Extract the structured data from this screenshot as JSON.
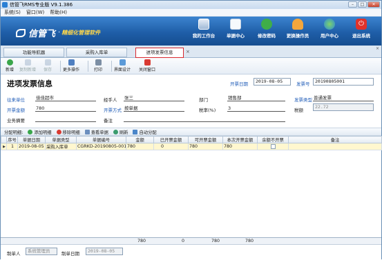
{
  "window": {
    "title": "信管飞RMS专业版 V9.1.386",
    "min": "–",
    "max": "□",
    "close": "✕"
  },
  "menu": [
    "系统(S)",
    "窗口(W)",
    "帮助(H)"
  ],
  "brand": {
    "name": "信管飞",
    "slogan": "精细化管理软件"
  },
  "topnav": [
    "我的工作台",
    "单据中心",
    "修改密码",
    "更换操作员",
    "用户中心",
    "退出系统"
  ],
  "tabs": {
    "items": [
      "功能导航器",
      "采购入库单",
      "进项发票信息"
    ],
    "close": "×"
  },
  "toolbar": {
    "new": "新增",
    "copy_new": "复制新增",
    "save": "保存",
    "more": "更多操作",
    "print": "打印",
    "design": "界面设计",
    "close": "关闭窗口"
  },
  "form": {
    "title": "进项发票信息",
    "invoice_date_label": "开票日期",
    "invoice_date": "2019-08-05",
    "invoice_no_label": "发票号",
    "invoice_no": "20190805001",
    "vendor_label": "往来单位",
    "vendor": "佳佳超市",
    "handler_label": "经手人",
    "handler": "张三",
    "dept_label": "部门",
    "dept": "销售部",
    "invoice_type_label": "发票类型",
    "invoice_type": "普通发票",
    "amount_label": "开票金额",
    "amount": "780",
    "method_label": "开票方式",
    "method": "按单据",
    "tax_rate_label": "税率(%)",
    "tax_rate": "3",
    "tax_label": "税额",
    "tax": "22.72",
    "biz_type_label": "业务摘要",
    "biz_type": "",
    "remark_label": "备注",
    "remark": ""
  },
  "detail_bar": {
    "label": "分配明细:",
    "add": "添加明细",
    "del": "移除明细",
    "view": "查看单据",
    "refresh": "刷新",
    "auto": "自动分配"
  },
  "table": {
    "headers": [
      "序号",
      "单据日期",
      "单据类型",
      "单据编号",
      "金额",
      "已开票金额",
      "可开票金额",
      "本次开票金额",
      "余额不开票",
      "备注"
    ],
    "rows": [
      {
        "no": "1",
        "date": "2019-08-05",
        "type": "采购入库单",
        "code": "CGRKD-20190805-0013",
        "amount": "780",
        "billed": "0",
        "billable": "780",
        "current": "780",
        "remark": ""
      }
    ],
    "totals": {
      "amount": "780",
      "billed": "0",
      "billable": "780",
      "current": "780"
    }
  },
  "footer": {
    "maker_label": "制单人",
    "maker": "系统管理员",
    "make_date_label": "制单日期",
    "make_date": "2019-08-05"
  }
}
